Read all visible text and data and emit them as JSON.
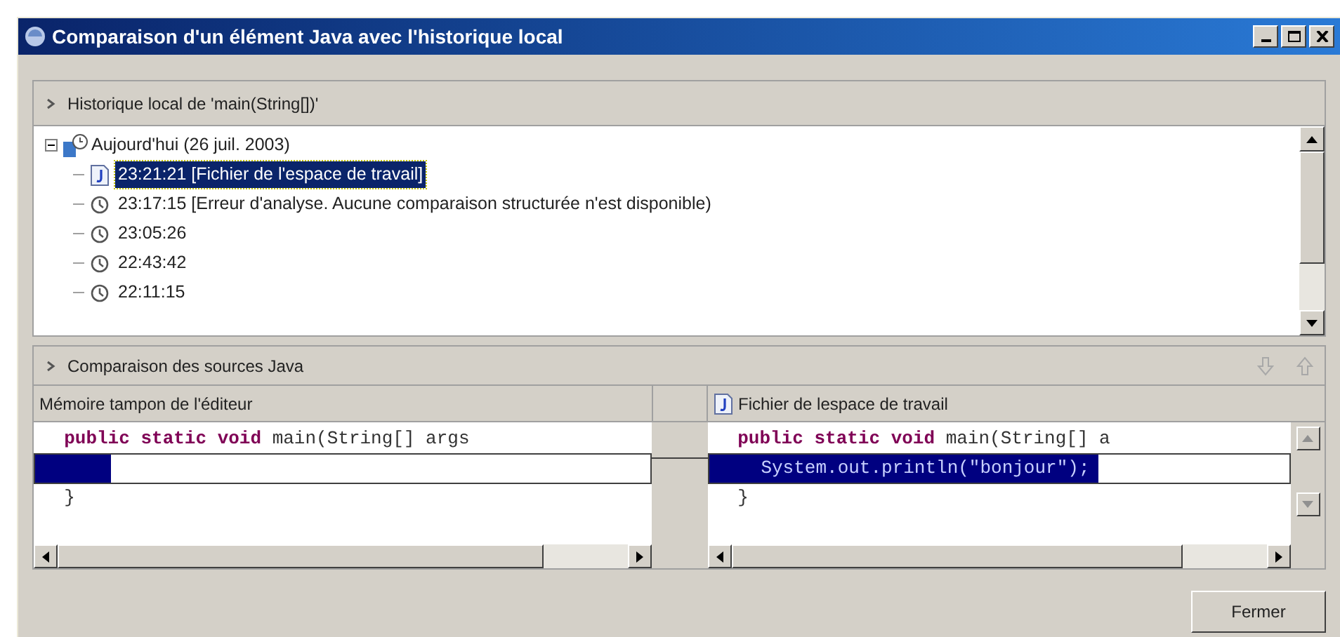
{
  "window": {
    "title": "Comparaison d'un élément Java avec l'historique local"
  },
  "history": {
    "title": "Historique local de 'main(String[])'",
    "tree": [
      {
        "label": "Aujourd'hui (26 juil. 2003)",
        "expanded": true,
        "children": [
          {
            "kind": "workspace",
            "label": "23:21:21 [Fichier de l'espace de travail]",
            "selected": true
          },
          {
            "kind": "history",
            "label": "23:17:15 [Erreur d'analyse. Aucune comparaison structurée n'est disponible)",
            "selected": false
          },
          {
            "kind": "history",
            "label": "23:05:26",
            "selected": false
          },
          {
            "kind": "history",
            "label": "22:43:42",
            "selected": false
          },
          {
            "kind": "history",
            "label": "22:11:15",
            "selected": false
          }
        ]
      }
    ]
  },
  "comparison": {
    "title": "Comparaison des sources Java",
    "panes": [
      {
        "title": "Mémoire tampon de l'éditeur",
        "lines": [
          {
            "highlighted": false,
            "tokens": [
              {
                "kind": "keyword",
                "text": "  public static void"
              },
              {
                "kind": "plain",
                "text": " main(String[] args"
              }
            ]
          },
          {
            "highlighted": true
          },
          {
            "highlighted": false,
            "tokens": [
              {
                "kind": "plain",
                "text": "  }"
              }
            ]
          }
        ]
      },
      {
        "title": "Fichier de lespace de travail",
        "lines": [
          {
            "highlighted": false,
            "tokens": [
              {
                "kind": "keyword",
                "text": "  public static void"
              },
              {
                "kind": "plain",
                "text": " main(String[] a"
              }
            ]
          },
          {
            "highlighted": true,
            "tokens": [
              {
                "kind": "plain",
                "text": "    System.out.println(\"bonjour\");"
              }
            ]
          },
          {
            "highlighted": false,
            "tokens": [
              {
                "kind": "plain",
                "text": "  }"
              }
            ]
          }
        ]
      }
    ]
  },
  "buttons": [
    {
      "label": "Fermer"
    }
  ]
}
